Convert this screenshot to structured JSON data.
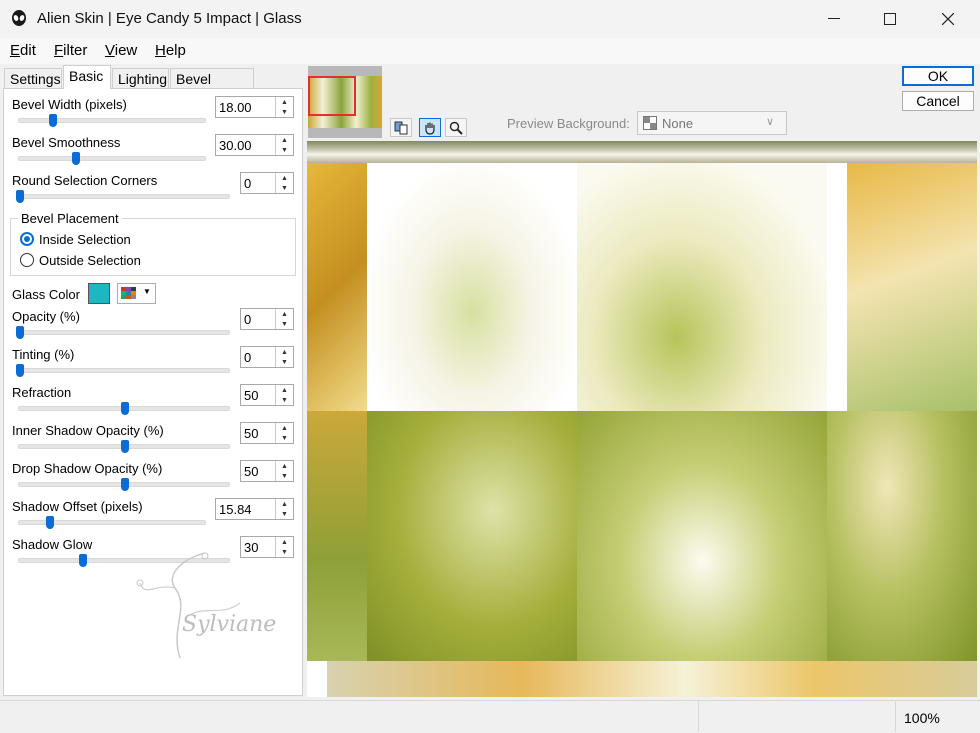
{
  "window": {
    "title": "Alien Skin | Eye Candy 5 Impact | Glass",
    "icon": "alien-head-icon"
  },
  "menu": [
    {
      "accel": "E",
      "rest": "dit"
    },
    {
      "accel": "F",
      "rest": "ilter"
    },
    {
      "accel": "V",
      "rest": "iew"
    },
    {
      "accel": "H",
      "rest": "elp"
    }
  ],
  "tabs": [
    "Settings",
    "Basic",
    "Lighting",
    "Bevel Profile"
  ],
  "active_tab": "Basic",
  "params": {
    "bevel_width": {
      "label": "Bevel Width (pixels)",
      "value": "18.00",
      "level": 0.18
    },
    "bevel_smoothness": {
      "label": "Bevel Smoothness",
      "value": "30.00",
      "level": 0.3
    },
    "round_corners": {
      "label": "Round Selection Corners",
      "value": "0",
      "level": 0
    },
    "opacity": {
      "label": "Opacity (%)",
      "value": "0",
      "level": 0
    },
    "tinting": {
      "label": "Tinting (%)",
      "value": "0",
      "level": 0
    },
    "refraction": {
      "label": "Refraction",
      "value": "50",
      "level": 0.5
    },
    "inner_shadow": {
      "label": "Inner Shadow Opacity (%)",
      "value": "50",
      "level": 0.5
    },
    "drop_shadow": {
      "label": "Drop Shadow Opacity (%)",
      "value": "50",
      "level": 0.5
    },
    "shadow_offset": {
      "label": "Shadow Offset (pixels)",
      "value": "15.84",
      "level": 0.16
    },
    "shadow_glow": {
      "label": "Shadow Glow",
      "value": "30",
      "level": 0.3
    }
  },
  "bevel_placement": {
    "label": "Bevel Placement",
    "inside": "Inside Selection",
    "outside": "Outside Selection",
    "selected": "inside"
  },
  "glass_color": {
    "label": "Glass Color",
    "value": "#1bb8c4"
  },
  "buttons": {
    "ok": "OK",
    "cancel": "Cancel"
  },
  "preview": {
    "background_label": "Preview Background:",
    "background_value": "None"
  },
  "status": {
    "zoom": "100%"
  },
  "watermark": "Sylviane",
  "colors": {
    "accent": "#0a6cd6"
  }
}
